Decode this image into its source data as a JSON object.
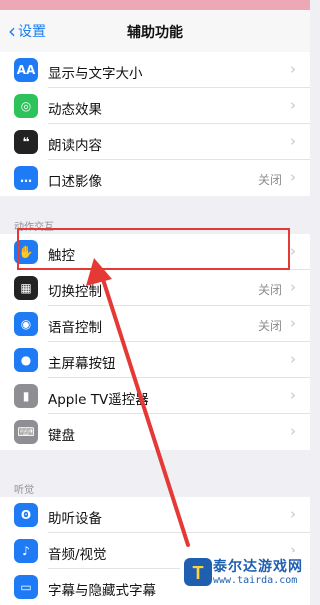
{
  "nav": {
    "back_label": "设置",
    "title": "辅助功能"
  },
  "group1": [
    {
      "label": "显示与文字大小",
      "icon": "text-size-icon",
      "color": "#1e7bf5",
      "glyph": "AA",
      "value": ""
    },
    {
      "label": "动态效果",
      "icon": "motion-icon",
      "color": "#2ec25b",
      "glyph": "◎",
      "value": ""
    },
    {
      "label": "朗读内容",
      "icon": "speech-bubble-icon",
      "color": "#222222",
      "glyph": "❝",
      "value": ""
    },
    {
      "label": "口述影像",
      "icon": "audio-description-icon",
      "color": "#1e7bf5",
      "glyph": "…",
      "value": "关闭"
    }
  ],
  "section2_title": "动作交互",
  "group2": [
    {
      "label": "触控",
      "icon": "touch-icon",
      "color": "#1e7bf5",
      "glyph": "✋",
      "value": ""
    },
    {
      "label": "切换控制",
      "icon": "switch-control-icon",
      "color": "#222222",
      "glyph": "▦",
      "value": "关闭"
    },
    {
      "label": "语音控制",
      "icon": "voice-control-icon",
      "color": "#1e7bf5",
      "glyph": "◉",
      "value": "关闭"
    },
    {
      "label": "主屏幕按钮",
      "icon": "home-button-icon",
      "color": "#1e7bf5",
      "glyph": "●",
      "value": ""
    },
    {
      "label": "Apple TV遥控器",
      "icon": "remote-icon",
      "color": "#8e8e93",
      "glyph": "▮",
      "value": ""
    },
    {
      "label": "键盘",
      "icon": "keyboard-icon",
      "color": "#8e8e93",
      "glyph": "⌨",
      "value": ""
    }
  ],
  "section3_title": "听觉",
  "group3": [
    {
      "label": "助听设备",
      "icon": "hearing-icon",
      "color": "#1e7bf5",
      "glyph": "ʘ",
      "value": ""
    },
    {
      "label": "音频/视觉",
      "icon": "audio-visual-icon",
      "color": "#1e7bf5",
      "glyph": "♪",
      "value": ""
    },
    {
      "label": "字幕与隐藏式字幕",
      "icon": "captions-icon",
      "color": "#1e7bf5",
      "glyph": "▭",
      "value": ""
    }
  ],
  "watermark": {
    "name": "泰尔达游戏网",
    "url": "www.tairda.com",
    "logo": "T"
  }
}
